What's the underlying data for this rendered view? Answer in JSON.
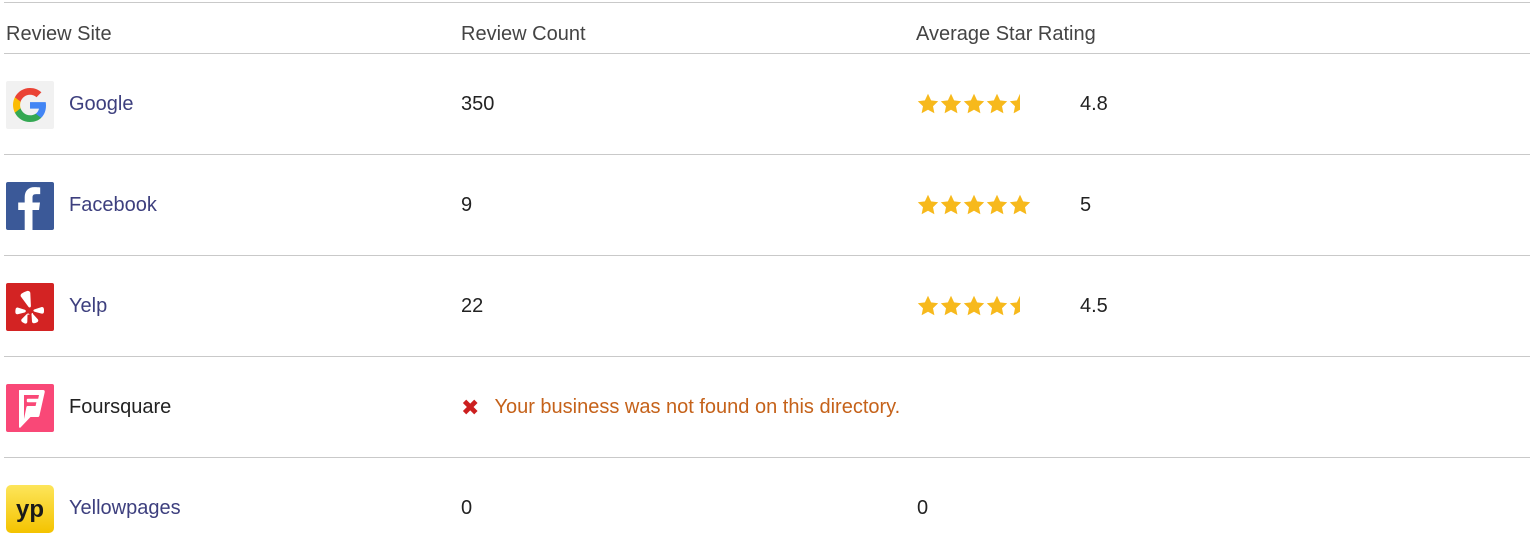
{
  "columns": {
    "site": "Review Site",
    "count": "Review Count",
    "rating": "Average Star Rating"
  },
  "rows": [
    {
      "site": "Google",
      "icon": "google-logo-icon",
      "count": "350",
      "stars": 4.5,
      "rating": "4.8"
    },
    {
      "site": "Facebook",
      "icon": "facebook-logo-icon",
      "count": "9",
      "stars": 5,
      "rating": "5"
    },
    {
      "site": "Yelp",
      "icon": "yelp-logo-icon",
      "count": "22",
      "stars": 4.5,
      "rating": "4.5"
    },
    {
      "site": "Foursquare",
      "icon": "foursquare-logo-icon",
      "not_found": "Your business was not found on this directory."
    },
    {
      "site": "Yellowpages",
      "icon": "yellowpages-logo-icon",
      "count": "0",
      "rating": "0"
    }
  ],
  "colors": {
    "star": "#f7b91c",
    "link": "#3d3f7e",
    "warning_text": "#c5621a",
    "error_icon": "#cc1f1f",
    "divider": "#c9c9c9"
  }
}
